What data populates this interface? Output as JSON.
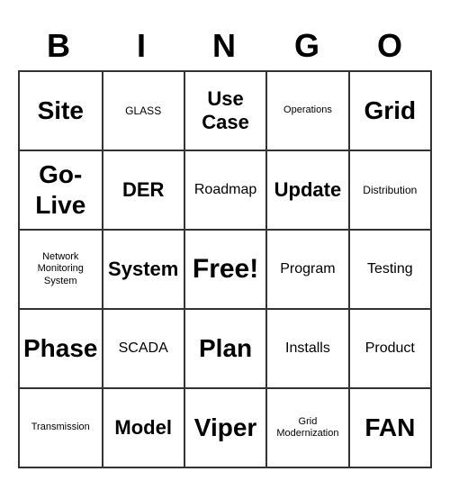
{
  "header": {
    "letters": [
      "B",
      "I",
      "N",
      "G",
      "O"
    ]
  },
  "cells": [
    {
      "text": "Site",
      "size": "xl"
    },
    {
      "text": "GLASS",
      "size": "sm"
    },
    {
      "text": "Use Case",
      "size": "lg"
    },
    {
      "text": "Operations",
      "size": "xs"
    },
    {
      "text": "Grid",
      "size": "xl"
    },
    {
      "text": "Go-Live",
      "size": "xl"
    },
    {
      "text": "DER",
      "size": "lg"
    },
    {
      "text": "Roadmap",
      "size": "md"
    },
    {
      "text": "Update",
      "size": "lg"
    },
    {
      "text": "Distribution",
      "size": "sm"
    },
    {
      "text": "Network Monitoring System",
      "size": "xs"
    },
    {
      "text": "System",
      "size": "lg"
    },
    {
      "text": "Free!",
      "size": "free"
    },
    {
      "text": "Program",
      "size": "md"
    },
    {
      "text": "Testing",
      "size": "md"
    },
    {
      "text": "Phase",
      "size": "xl"
    },
    {
      "text": "SCADA",
      "size": "md"
    },
    {
      "text": "Plan",
      "size": "xl"
    },
    {
      "text": "Installs",
      "size": "md"
    },
    {
      "text": "Product",
      "size": "md"
    },
    {
      "text": "Transmission",
      "size": "xs"
    },
    {
      "text": "Model",
      "size": "lg"
    },
    {
      "text": "Viper",
      "size": "xl"
    },
    {
      "text": "Grid Modernization",
      "size": "xs"
    },
    {
      "text": "FAN",
      "size": "xl"
    }
  ]
}
